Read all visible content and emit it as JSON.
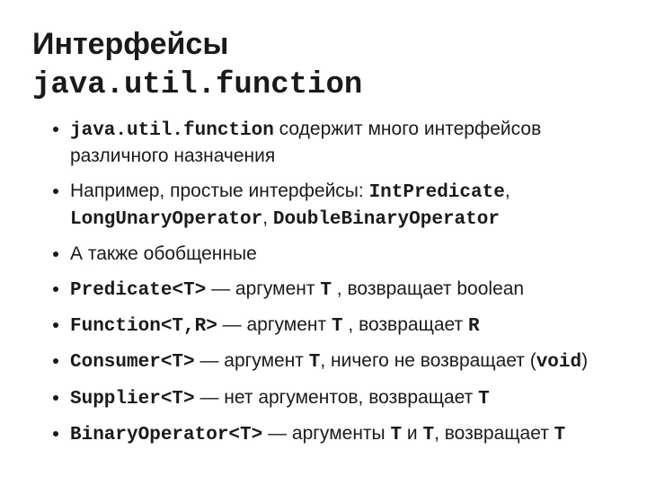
{
  "title_plain": "Интерфейсы ",
  "title_code": "java.util.function",
  "bullets": [
    {
      "segments": [
        {
          "t": "java.util.function",
          "c": true
        },
        {
          "t": " содержит много интерфейсов различного назначения"
        }
      ]
    },
    {
      "segments": [
        {
          "t": "Например, простые интерфейсы: "
        },
        {
          "t": "IntPredicate",
          "c": true
        },
        {
          "t": ", "
        },
        {
          "t": "LongUnaryOperator",
          "c": true
        },
        {
          "t": ", "
        },
        {
          "t": "DoubleBinaryOperator",
          "c": true
        }
      ]
    },
    {
      "segments": [
        {
          "t": "А также обобщенные"
        }
      ]
    },
    {
      "segments": [
        {
          "t": "Predicate<T>",
          "c": true
        },
        {
          "t": " — аргумент "
        },
        {
          "t": "T",
          "c": true
        },
        {
          "t": " , возвращает boolean"
        }
      ]
    },
    {
      "segments": [
        {
          "t": "Function<T,R>",
          "c": true
        },
        {
          "t": " — аргумент "
        },
        {
          "t": "T",
          "c": true
        },
        {
          "t": " , возвращает "
        },
        {
          "t": "R",
          "c": true
        }
      ]
    },
    {
      "segments": [
        {
          "t": "Consumer<T>",
          "c": true
        },
        {
          "t": " — аргумент "
        },
        {
          "t": "T",
          "c": true
        },
        {
          "t": ", ничего не возвращает ("
        },
        {
          "t": "void",
          "c": true
        },
        {
          "t": ")"
        }
      ]
    },
    {
      "segments": [
        {
          "t": "Supplier<T>",
          "c": true
        },
        {
          "t": " — нет аргументов, возвращает "
        },
        {
          "t": "T",
          "c": true
        }
      ]
    },
    {
      "segments": [
        {
          "t": "BinaryOperator<T>",
          "c": true
        },
        {
          "t": " — аргументы "
        },
        {
          "t": "T",
          "c": true
        },
        {
          "t": " и "
        },
        {
          "t": "T",
          "c": true
        },
        {
          "t": ", возвращает "
        },
        {
          "t": "T",
          "c": true
        }
      ]
    }
  ]
}
